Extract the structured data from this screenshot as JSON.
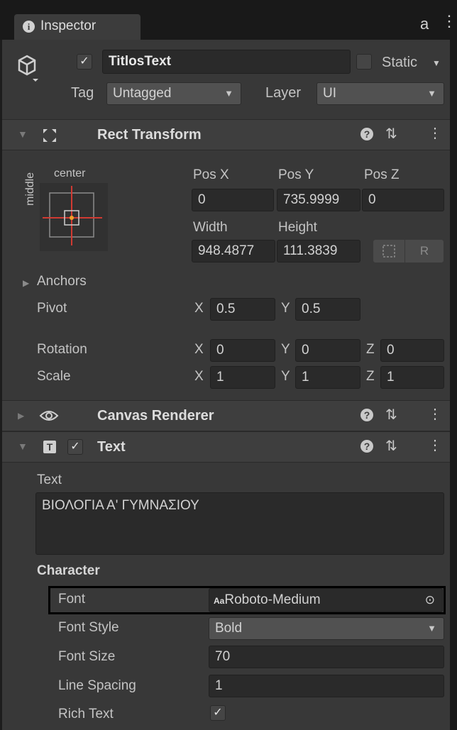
{
  "window": {
    "tab_label": "Inspector",
    "tab_info_glyph": "i",
    "lock_glyph": "a",
    "menu_glyph": "⋮"
  },
  "object": {
    "active_checked": true,
    "check_glyph": "✓",
    "name": "TitlosText",
    "static_label": "Static",
    "static_checked": false,
    "tag_label": "Tag",
    "tag_value": "Untagged",
    "layer_label": "Layer",
    "layer_value": "UI",
    "dropdown_glyph": "▼"
  },
  "rect_transform": {
    "title": "Rect Transform",
    "anchor_preset_h": "center",
    "anchor_preset_v": "middle",
    "pos_x_label": "Pos X",
    "pos_y_label": "Pos Y",
    "pos_z_label": "Pos Z",
    "pos_x": "0",
    "pos_y": "735.9999",
    "pos_z": "0",
    "width_label": "Width",
    "height_label": "Height",
    "width": "948.4877",
    "height": "111.3839",
    "raw_edit_label": "R",
    "anchors_label": "Anchors",
    "pivot_label": "Pivot",
    "pivot_x_label": "X",
    "pivot_y_label": "Y",
    "pivot_x": "0.5",
    "pivot_y": "0.5",
    "rotation_label": "Rotation",
    "scale_label": "Scale",
    "axis_x": "X",
    "axis_y": "Y",
    "axis_z": "Z",
    "rotation": {
      "x": "0",
      "y": "0",
      "z": "0"
    },
    "scale": {
      "x": "1",
      "y": "1",
      "z": "1"
    }
  },
  "canvas_renderer": {
    "title": "Canvas Renderer"
  },
  "text_component": {
    "title": "Text",
    "enabled": true,
    "text_label": "Text",
    "text_value": "ΒΙΟΛΟΓΙΑ Α' ΓΥΜΝΑΣΙΟΥ",
    "character_label": "Character",
    "font_label": "Font",
    "font_value": "Roboto-Medium",
    "font_prefix": "Aa",
    "font_style_label": "Font Style",
    "font_style_value": "Bold",
    "font_size_label": "Font Size",
    "font_size_value": "70",
    "line_spacing_label": "Line Spacing",
    "line_spacing_value": "1",
    "rich_text_label": "Rich Text",
    "rich_text_checked": true
  },
  "colors": {
    "panel_bg": "#383838",
    "header_bg": "#3e3e3e",
    "field_bg": "#2a2a2a",
    "highlight_border": "#000000",
    "anchor_red": "#d13a32",
    "anchor_orange": "#f0a02a"
  },
  "icons": {
    "gameobject": "cube-icon",
    "rect_transform": "rect-transform-icon",
    "canvas_renderer": "eye-icon",
    "text": "text-component-icon",
    "help": "help-icon",
    "preset": "preset-icon",
    "object_picker": "object-picker-icon"
  }
}
